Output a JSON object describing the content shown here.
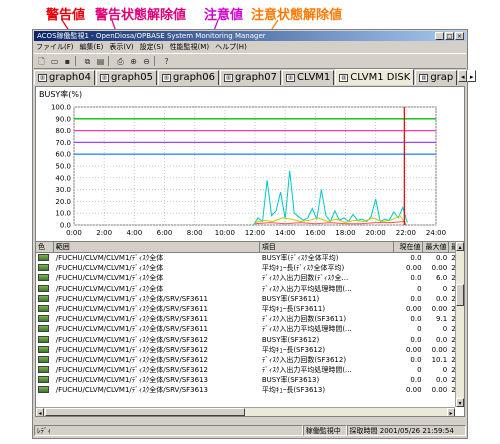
{
  "annotations": [
    {
      "label": "警告値",
      "color": "#e8000b"
    },
    {
      "label": "警告状態解除値",
      "color": "#e0007a"
    },
    {
      "label": "注意値",
      "color": "#d000d0"
    },
    {
      "label": "注意状態解除値",
      "color": "#ff7a00"
    }
  ],
  "window": {
    "title": "ACOS稼働監視1 - OpenDiosa/OPBASE System Monitoring Manager",
    "controls": [
      "_",
      "□",
      "×"
    ]
  },
  "menu": [
    "ファイル(F)",
    "編集(E)",
    "表示(V)",
    "設定(S)",
    "性能監視(M)",
    "ヘルプ(H)"
  ],
  "toolbar_icons": [
    "new-icon",
    "open-icon",
    "save-icon",
    "copy-icon",
    "paste-icon",
    "print-icon",
    "zoom-in-icon",
    "zoom-out-icon",
    "help-icon"
  ],
  "tabs": [
    {
      "label": "graph04",
      "active": false
    },
    {
      "label": "graph05",
      "active": false
    },
    {
      "label": "graph06",
      "active": false
    },
    {
      "label": "graph07",
      "active": false
    },
    {
      "label": "CLVM1",
      "active": false
    },
    {
      "label": "CLVM1 DISK",
      "active": true
    },
    {
      "label": "grap",
      "active": false
    }
  ],
  "graph": {
    "ylabel": "BUSY率(%)"
  },
  "chart_data": {
    "type": "line",
    "ylabel": "BUSY率(%)",
    "ylim": [
      0,
      100
    ],
    "yticks": [
      "0.0",
      "10.0",
      "20.0",
      "30.0",
      "40.0",
      "50.0",
      "60.0",
      "70.0",
      "80.0",
      "90.0",
      "100.0"
    ],
    "xlim": [
      0,
      24
    ],
    "xticks": [
      "0:00",
      "2:00",
      "4:00",
      "6:00",
      "8:00",
      "10:00",
      "12:00",
      "14:00",
      "16:00",
      "18:00",
      "20:00",
      "22:00",
      "24:00"
    ],
    "grid": true,
    "threshold_lines": [
      {
        "name": "警告値",
        "value": 90,
        "color": "#00c000"
      },
      {
        "name": "警告状態解除値",
        "value": 80,
        "color": "#ff3ab5"
      },
      {
        "name": "注意値",
        "value": 70,
        "color": "#9a47ff"
      },
      {
        "name": "注意状態解除値",
        "value": 60,
        "color": "#2f8cff"
      }
    ],
    "marker": {
      "x": 21.9,
      "color": "#e00000"
    },
    "series": [
      {
        "color": "#00c8c8",
        "x": [
          11.9,
          12.2,
          12.5,
          12.8,
          13.1,
          13.4,
          13.7,
          14.0,
          14.3,
          14.6,
          14.9,
          15.2,
          15.5,
          15.8,
          16.1,
          16.4,
          16.7,
          17.0,
          17.3,
          17.6,
          17.9,
          18.2,
          18.5,
          18.8,
          19.1,
          19.4,
          19.7,
          20.0,
          20.3,
          20.6,
          20.9,
          21.2,
          21.5,
          21.8,
          22.1
        ],
        "y": [
          0,
          6,
          3,
          38,
          8,
          12,
          28,
          5,
          46,
          10,
          7,
          4,
          6,
          14,
          5,
          30,
          8,
          3,
          12,
          4,
          6,
          3,
          9,
          4,
          5,
          3,
          7,
          22,
          3,
          5,
          4,
          11,
          6,
          15,
          2
        ]
      },
      {
        "color": "#c8c800",
        "x": [
          12.0,
          12.6,
          13.2,
          13.8,
          14.4,
          15.0,
          15.6,
          16.2,
          16.8,
          17.4,
          18.0,
          18.6,
          19.2,
          19.8,
          20.4,
          21.0,
          21.6,
          22.0
        ],
        "y": [
          2,
          4,
          3,
          6,
          5,
          3,
          4,
          6,
          3,
          5,
          2,
          4,
          3,
          6,
          3,
          4,
          8,
          1
        ]
      },
      {
        "color": "#ff5050",
        "x": [
          12.0,
          13.0,
          14.0,
          15.0,
          16.0,
          17.0,
          18.0,
          19.0,
          20.0,
          21.0,
          21.9,
          22.0
        ],
        "y": [
          1,
          2,
          1,
          2,
          1,
          2,
          1,
          1,
          2,
          2,
          3,
          0
        ]
      }
    ]
  },
  "table": {
    "columns": [
      "色",
      "範囲",
      "項目",
      "現在値",
      "最大値",
      "最ﾌ"
    ],
    "rows": [
      {
        "range": "/FUCHU/CLVM/CLVM1/ﾃﾞｨｽｸ全体",
        "item": "BUSY率(ﾃﾞｨｽｸ全体平均)",
        "current": "0.0",
        "max": "0.0",
        "last": "200"
      },
      {
        "range": "/FUCHU/CLVM/CLVM1/ﾃﾞｨｽｸ全体",
        "item": "平均ｷｭｰ長(ﾃﾞｨｽｸ全体平均)",
        "current": "0.00",
        "max": "0.00",
        "last": "200"
      },
      {
        "range": "/FUCHU/CLVM/CLVM1/ﾃﾞｨｽｸ全体",
        "item": "ﾃﾞｨｽｸ入出力回数(ﾃﾞｨｽｸ全...",
        "current": "0.0",
        "max": "6.0",
        "last": "200"
      },
      {
        "range": "/FUCHU/CLVM/CLVM1/ﾃﾞｨｽｸ全体",
        "item": "ﾃﾞｨｽｸ入出力平均処理時間(...",
        "current": "0",
        "max": "0",
        "last": "200"
      },
      {
        "range": "/FUCHU/CLVM/CLVM1/ﾃﾞｨｽｸ全体/SRV/SF3611",
        "item": "BUSY率(SF3611)",
        "current": "0.0",
        "max": "0.0",
        "last": "200"
      },
      {
        "range": "/FUCHU/CLVM/CLVM1/ﾃﾞｨｽｸ全体/SRV/SF3611",
        "item": "平均ｷｭｰ長(SF3611)",
        "current": "0.00",
        "max": "0.00",
        "last": "200"
      },
      {
        "range": "/FUCHU/CLVM/CLVM1/ﾃﾞｨｽｸ全体/SRV/SF3611",
        "item": "ﾃﾞｨｽｸ入出力回数(SF3611)",
        "current": "0.0",
        "max": "9.1",
        "last": "200"
      },
      {
        "range": "/FUCHU/CLVM/CLVM1/ﾃﾞｨｽｸ全体/SRV/SF3611",
        "item": "ﾃﾞｨｽｸ入出力平均処理時間(...",
        "current": "0",
        "max": "0",
        "last": "200"
      },
      {
        "range": "/FUCHU/CLVM/CLVM1/ﾃﾞｨｽｸ全体/SRV/SF3612",
        "item": "BUSY率(SF3612)",
        "current": "0.0",
        "max": "0.0",
        "last": "200"
      },
      {
        "range": "/FUCHU/CLVM/CLVM1/ﾃﾞｨｽｸ全体/SRV/SF3612",
        "item": "平均ｷｭｰ長(SF3612)",
        "current": "0.00",
        "max": "0.00",
        "last": "200"
      },
      {
        "range": "/FUCHU/CLVM/CLVM1/ﾃﾞｨｽｸ全体/SRV/SF3612",
        "item": "ﾃﾞｨｽｸ入出力回数(SF3612)",
        "current": "0.0",
        "max": "10.1",
        "last": "200"
      },
      {
        "range": "/FUCHU/CLVM/CLVM1/ﾃﾞｨｽｸ全体/SRV/SF3612",
        "item": "ﾃﾞｨｽｸ入出力平均処理時間(...",
        "current": "0",
        "max": "0",
        "last": "200"
      },
      {
        "range": "/FUCHU/CLVM/CLVM1/ﾃﾞｨｽｸ全体/SRV/SF3613",
        "item": "BUSY率(SF3613)",
        "current": "0.0",
        "max": "0.0",
        "last": "200"
      },
      {
        "range": "/FUCHU/CLVM/CLVM1/ﾃﾞｨｽｸ全体/SRV/SF3613",
        "item": "平均ｷｭｰ長(SF3613)",
        "current": "0.00",
        "max": "0.00",
        "last": "200"
      }
    ]
  },
  "status": {
    "left": "ﾚﾃﾞｨ",
    "state": "稼働監視中",
    "time": "採取時間 2001/05/26 21:59:54"
  }
}
